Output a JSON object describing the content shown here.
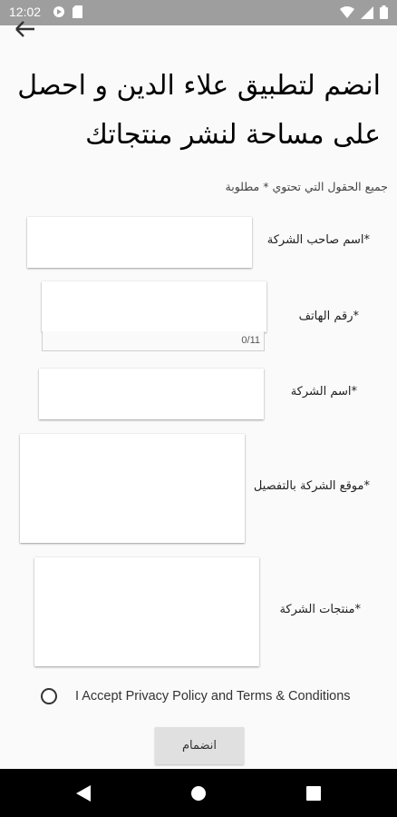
{
  "status_bar": {
    "time": "12:02"
  },
  "form": {
    "title": "انضم لتطبيق علاء الدين و احصل على مساحة لنشر منتجاتك",
    "required_note": "جميع الحقول التي تحتوي * مطلوبة",
    "fields": [
      {
        "label": "*اسم صاحب الشركة",
        "value": ""
      },
      {
        "label": "*رقم الهاتف",
        "value": "",
        "counter": "0/11"
      },
      {
        "label": "*اسم الشركة",
        "value": ""
      },
      {
        "label": "*موقع الشركة بالتفصيل",
        "value": ""
      },
      {
        "label": "*منتجات الشركة",
        "value": ""
      }
    ],
    "privacy_label": "I Accept Privacy Policy and Terms & Conditions",
    "join_label": "انضمام"
  }
}
